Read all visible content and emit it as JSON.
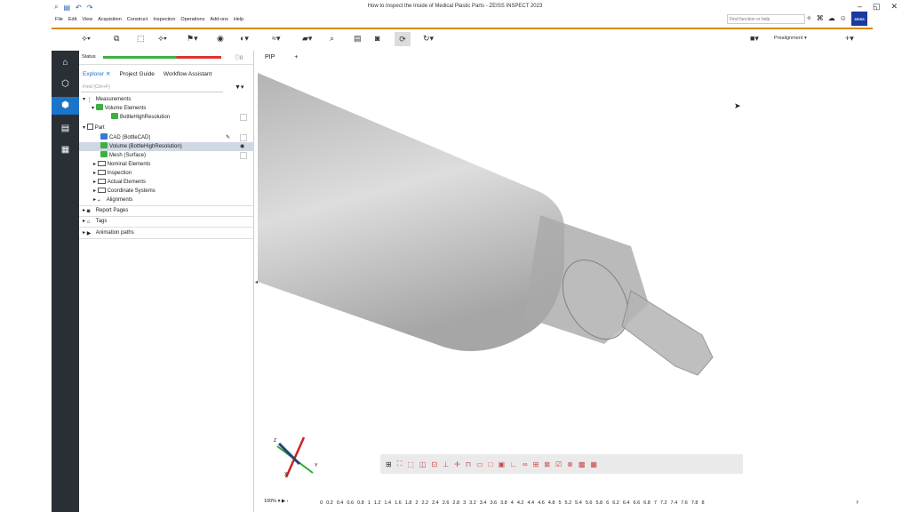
{
  "window": {
    "title": "How to Inspect the Inside of Medical Plastic Parts - ZEISS INSPECT 2023"
  },
  "menu": [
    "File",
    "Edit",
    "View",
    "Acquisition",
    "Construct",
    "Inspection",
    "Operations",
    "Add-ons",
    "Help"
  ],
  "search": {
    "placeholder": "Find function or help"
  },
  "brand": {
    "logo_text": "ZEISS"
  },
  "toolbar": {
    "prealignment": "Prealignment"
  },
  "status": {
    "label": "Status",
    "count": "0"
  },
  "explorer": {
    "tabs": [
      "Explorer",
      "Project Guide",
      "Workflow Assistant"
    ],
    "find_placeholder": "Find (Ctrl+F)",
    "tree": [
      {
        "label": "Measurements"
      },
      {
        "label": "Volume Elements"
      },
      {
        "label": "BottleHighResolution"
      },
      {
        "label": "Part"
      },
      {
        "label": "CAD (BottleCAD)"
      },
      {
        "label": "Volume (BottleHighResolution)"
      },
      {
        "label": "Mesh (Surface)"
      },
      {
        "label": "Nominal Elements"
      },
      {
        "label": "Inspection"
      },
      {
        "label": "Actual Elements"
      },
      {
        "label": "Coordinate Systems"
      },
      {
        "label": "Alignments"
      },
      {
        "label": "Report Pages"
      },
      {
        "label": "Tags"
      },
      {
        "label": "Animation paths"
      }
    ]
  },
  "viewport": {
    "tab": "PIP",
    "axes": {
      "x": "X",
      "y": "Y",
      "z": "Z"
    },
    "zoom": "100%",
    "timeline_labels": [
      "0",
      "0.2",
      "0.4",
      "0.6",
      "0.8",
      "1",
      "1.2",
      "1.4",
      "1.6",
      "1.8",
      "2",
      "2.2",
      "2.4",
      "2.6",
      "2.8",
      "3",
      "3.2",
      "3.4",
      "3.6",
      "3.8",
      "4",
      "4.2",
      "4.4",
      "4.6",
      "4.8",
      "5",
      "5.2",
      "5.4",
      "5.6",
      "5.8",
      "6",
      "6.2",
      "6.4",
      "6.6",
      "6.8",
      "7",
      "7.2",
      "7.4",
      "7.6",
      "7.8",
      "8"
    ]
  },
  "colors": {
    "accent": "#d98a1a",
    "nav_active": "#1a74c8",
    "brand": "#1a3aa0"
  }
}
